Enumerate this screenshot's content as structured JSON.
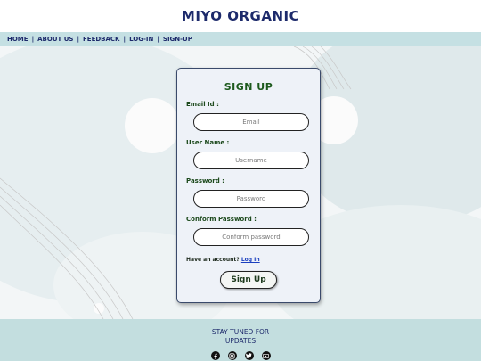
{
  "header": {
    "title": "MIYO ORGANIC"
  },
  "nav": {
    "items": [
      {
        "label": "HOME"
      },
      {
        "label": "ABOUT US"
      },
      {
        "label": "FEEDBACK"
      },
      {
        "label": "LOG-IN"
      },
      {
        "label": "SIGN-UP"
      }
    ],
    "separator": "|"
  },
  "form": {
    "title": "SIGN UP",
    "email_label": "Email Id :",
    "email_placeholder": "Email",
    "username_label": "User Name :",
    "username_placeholder": "Username",
    "password_label": "Password :",
    "password_placeholder": "Password",
    "confirm_label": "Conform Password :",
    "confirm_placeholder": "Conform password",
    "account_text": "Have an account?",
    "login_link": "Log In",
    "submit_label": "Sign Up"
  },
  "footer": {
    "tagline": "STAY TUNED FOR UPDATES",
    "social_icons": [
      "facebook-icon",
      "instagram-icon",
      "twitter-icon",
      "youtube-icon"
    ]
  },
  "colors": {
    "brand_navy": "#1d2a6b",
    "nav_bg": "#c5e0e3",
    "form_heading_green": "#1d5a1d",
    "footer_bg": "#c3dedf"
  }
}
